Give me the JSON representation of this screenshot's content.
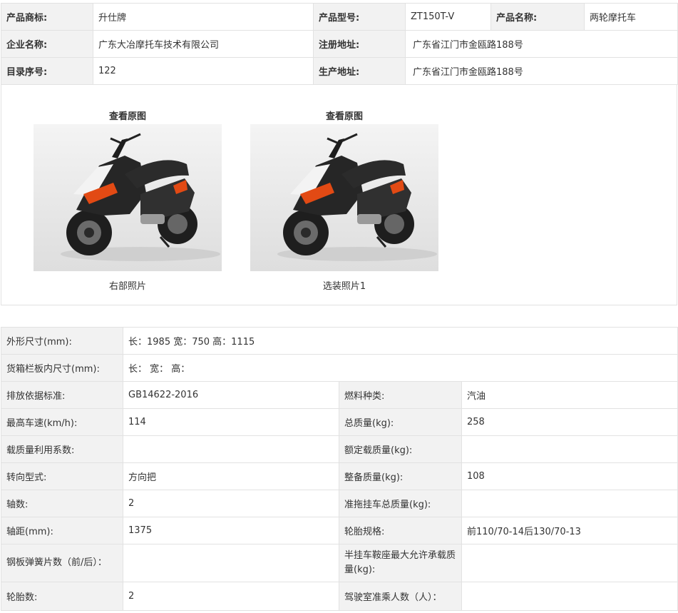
{
  "top": {
    "rows": [
      [
        {
          "l": "产品商标:",
          "v": "升仕牌"
        },
        {
          "l": "产品型号:",
          "v": "ZT150T-V"
        },
        {
          "l": "产品名称:",
          "v": "两轮摩托车"
        }
      ],
      [
        {
          "l": "企业名称:",
          "v": "广东大冶摩托车技术有限公司"
        },
        {
          "l": "注册地址:",
          "v": "广东省江门市金瓯路188号"
        }
      ],
      [
        {
          "l": "目录序号:",
          "v": "122"
        },
        {
          "l": "生产地址:",
          "v": "广东省江门市金瓯路188号"
        }
      ]
    ]
  },
  "photos": [
    {
      "title": "查看原图",
      "caption": "右部照片"
    },
    {
      "title": "查看原图",
      "caption": "选装照片1"
    }
  ],
  "spec": {
    "dimensions": {
      "label": "外形尺寸(mm):",
      "value": "长：1985 宽：750 高：1115"
    },
    "cargo": {
      "label": "货箱栏板内尺寸(mm):",
      "value": "长：  宽：  高："
    },
    "rows": [
      [
        {
          "l": "排放依据标准:",
          "v": "GB14622-2016"
        },
        {
          "l": "燃料种类:",
          "v": "汽油"
        }
      ],
      [
        {
          "l": "最高车速(km/h):",
          "v": "114"
        },
        {
          "l": "总质量(kg):",
          "v": "258"
        }
      ],
      [
        {
          "l": "载质量利用系数:",
          "v": ""
        },
        {
          "l": "额定载质量(kg):",
          "v": ""
        }
      ],
      [
        {
          "l": "转向型式:",
          "v": "方向把"
        },
        {
          "l": "整备质量(kg):",
          "v": "108"
        }
      ],
      [
        {
          "l": "轴数:",
          "v": "2"
        },
        {
          "l": "准拖挂车总质量(kg):",
          "v": ""
        }
      ],
      [
        {
          "l": "轴距(mm):",
          "v": "1375"
        },
        {
          "l": "轮胎规格:",
          "v": "前110/70-14后130/70-13"
        }
      ],
      [
        {
          "l": "钢板弹簧片数（前/后）：",
          "v": ""
        },
        {
          "l": "半挂车鞍座最大允许承载质量(kg):",
          "v": ""
        }
      ],
      [
        {
          "l": "轮胎数:",
          "v": "2"
        },
        {
          "l": "驾驶室准乘人数（人）：",
          "v": ""
        }
      ]
    ]
  }
}
